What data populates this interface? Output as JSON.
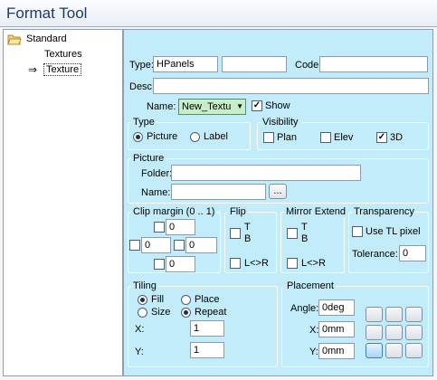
{
  "window": {
    "title": "Format Tool"
  },
  "tree": {
    "root": "Standard",
    "items": [
      "Textures",
      "Texture"
    ]
  },
  "header": {
    "type_label": "Type:",
    "type_value": "HPanels",
    "code_label": "Code:",
    "desc_label": "Desc:",
    "name_label": "Name:",
    "name_value": "New_Textu",
    "show_label": "Show"
  },
  "type_group": {
    "title": "Type",
    "options": [
      "Picture",
      "Label"
    ],
    "selected": "Picture"
  },
  "visibility": {
    "title": "Visibility",
    "items": [
      {
        "label": "Plan",
        "checked": false
      },
      {
        "label": "Elev",
        "checked": false
      },
      {
        "label": "3D",
        "checked": true
      }
    ]
  },
  "picture": {
    "title": "Picture",
    "folder_label": "Folder:",
    "name_label": "Name:",
    "browse_label": "..."
  },
  "clip": {
    "title": "Clip margin (0 .. 1)",
    "top": "0",
    "left": "0",
    "right": "0",
    "bottom": "0"
  },
  "flip": {
    "title": "Flip",
    "tb_top": "T",
    "tb_bottom": "B",
    "lr": "L<>R"
  },
  "mirror": {
    "title": "Mirror Extend",
    "tb_top": "T",
    "tb_bottom": "B",
    "lr": "L<>R"
  },
  "transparency": {
    "title": "Transparency",
    "use_label": "Use TL pixel",
    "tolerance_label": "Tolerance:",
    "tolerance_value": "0"
  },
  "tiling": {
    "title": "Tiling",
    "options": [
      "Fill",
      "Place",
      "Size",
      "Repeat"
    ],
    "selected": [
      "Fill",
      "Repeat"
    ],
    "x_label": "X:",
    "x_value": "1",
    "y_label": "Y:",
    "y_value": "1"
  },
  "placement": {
    "title": "Placement",
    "angle_label": "Angle:",
    "angle_value": "0deg",
    "x_label": "X:",
    "x_value": "0mm",
    "y_label": "Y:",
    "y_value": "0mm"
  },
  "colors": {
    "panel": "#c3ecfa",
    "accent": "#3c7fb1"
  }
}
